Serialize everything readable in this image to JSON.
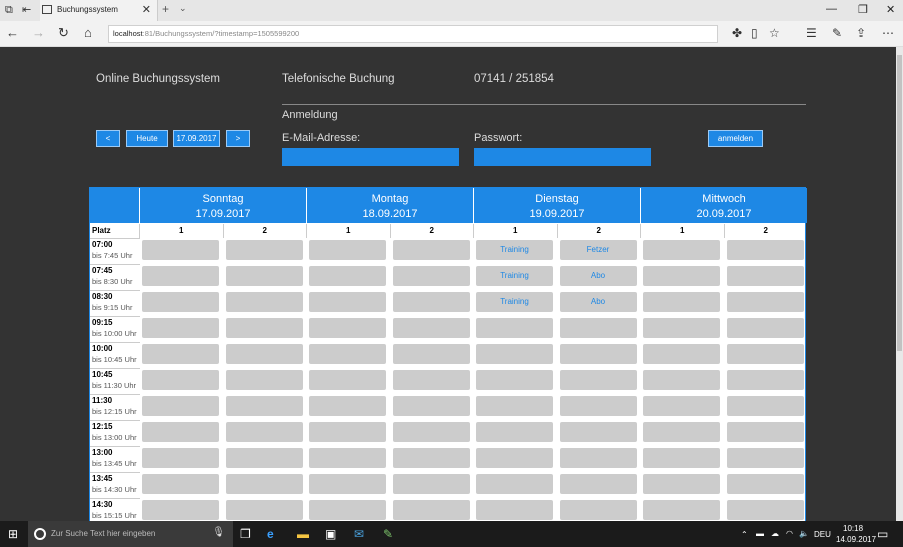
{
  "browser": {
    "tab_title": "Buchungssystem",
    "url_host": "localhost",
    "url_rest": ":81/Buchungssystem/?timestamp=1505599200"
  },
  "header": {
    "site_name": "Online Buchungssystem",
    "phone_label": "Telefonische Buchung",
    "phone_number": "07141 / 251854"
  },
  "login": {
    "title": "Anmeldung",
    "email_label": "E-Mail-Adresse:",
    "password_label": "Passwort:",
    "submit_label": "anmelden"
  },
  "datenav": {
    "prev_label": "<",
    "today_label": "Heute",
    "current_date": "17.09.2017",
    "next_label": ">"
  },
  "schedule": {
    "platz_label": "Platz",
    "days": [
      {
        "name": "Sonntag",
        "date": "17.09.2017",
        "courts": [
          "1",
          "2"
        ]
      },
      {
        "name": "Montag",
        "date": "18.09.2017",
        "courts": [
          "1",
          "2"
        ]
      },
      {
        "name": "Dienstag",
        "date": "19.09.2017",
        "courts": [
          "1",
          "2"
        ]
      },
      {
        "name": "Mittwoch",
        "date": "20.09.2017",
        "courts": [
          "1",
          "2"
        ]
      }
    ],
    "times": [
      {
        "start": "07:00",
        "end": "bis 7:45 Uhr"
      },
      {
        "start": "07:45",
        "end": "bis 8:30 Uhr"
      },
      {
        "start": "08:30",
        "end": "bis 9:15 Uhr"
      },
      {
        "start": "09:15",
        "end": "bis 10:00 Uhr"
      },
      {
        "start": "10:00",
        "end": "bis 10:45 Uhr"
      },
      {
        "start": "10:45",
        "end": "bis 11:30 Uhr"
      },
      {
        "start": "11:30",
        "end": "bis 12:15 Uhr"
      },
      {
        "start": "12:15",
        "end": "bis 13:00 Uhr"
      },
      {
        "start": "13:00",
        "end": "bis 13:45 Uhr"
      },
      {
        "start": "13:45",
        "end": "bis 14:30 Uhr"
      },
      {
        "start": "14:30",
        "end": "bis 15:15 Uhr"
      }
    ],
    "bookings": [
      [
        "",
        "",
        "",
        "",
        "Training",
        "Fetzer",
        "",
        ""
      ],
      [
        "",
        "",
        "",
        "",
        "Training",
        "Abo",
        "",
        ""
      ],
      [
        "",
        "",
        "",
        "",
        "Training",
        "Abo",
        "",
        ""
      ],
      [
        "",
        "",
        "",
        "",
        "",
        "",
        "",
        ""
      ],
      [
        "",
        "",
        "",
        "",
        "",
        "",
        "",
        ""
      ],
      [
        "",
        "",
        "",
        "",
        "",
        "",
        "",
        ""
      ],
      [
        "",
        "",
        "",
        "",
        "",
        "",
        "",
        ""
      ],
      [
        "",
        "",
        "",
        "",
        "",
        "",
        "",
        ""
      ],
      [
        "",
        "",
        "",
        "",
        "",
        "",
        "",
        ""
      ],
      [
        "",
        "",
        "",
        "",
        "",
        "",
        "",
        ""
      ],
      [
        "",
        "",
        "",
        "",
        "",
        "",
        "",
        ""
      ]
    ]
  },
  "taskbar": {
    "search_placeholder": "Zur Suche Text hier eingeben",
    "language": "DEU",
    "time": "10:18",
    "date": "14.09.2017"
  },
  "colors": {
    "accent": "#1e88e5",
    "page_bg": "#333333",
    "slot": "#cccccc"
  }
}
